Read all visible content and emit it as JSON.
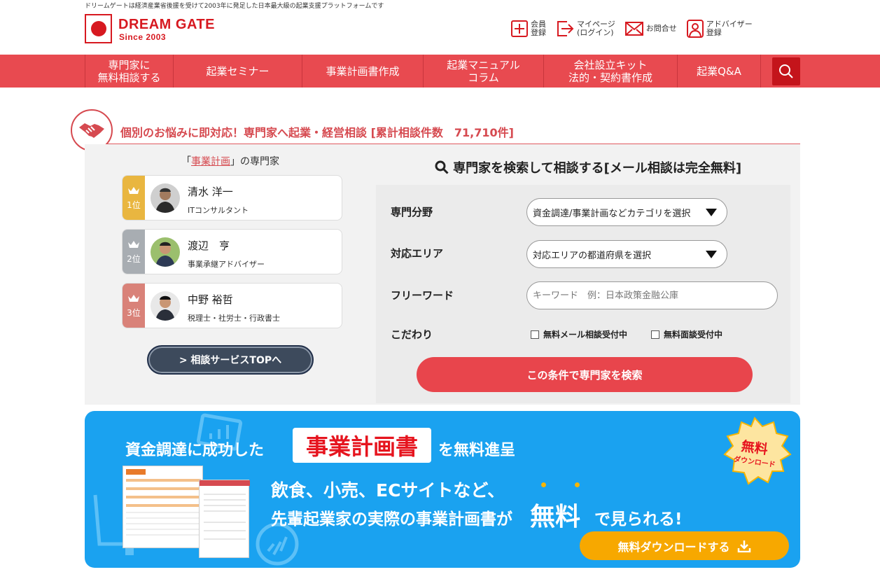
{
  "header": {
    "tagline": "ドリームゲートは経済産業省後援を受けて2003年に発足した日本最大級の起業支援プラットフォームです",
    "logo_name": "DREAM GATE",
    "logo_since": "Since 2003",
    "links": [
      {
        "label": "会員\n登録",
        "icon": "plus-square-icon"
      },
      {
        "label": "マイページ\n(ログイン)",
        "icon": "login-arrow-icon"
      },
      {
        "label": "お問合せ",
        "icon": "mail-icon"
      },
      {
        "label": "アドバイザー\n登録",
        "icon": "advisor-icon"
      }
    ]
  },
  "nav": {
    "items": [
      "専門家に\n無料相談する",
      "起業セミナー",
      "事業計画書作成",
      "起業マニュアル\nコラム",
      "会社設立キット\n法的・契約書作成",
      "起業Q&A"
    ],
    "search_icon": "search-icon"
  },
  "section": {
    "title": "個別のお悩みに即対応！専門家へ起業・経営相談 [累計相談件数　71,710件]",
    "icon": "handshake-icon"
  },
  "experts": {
    "title_prefix": "「",
    "title_highlight": "事業計画",
    "title_suffix": "」の専門家",
    "list": [
      {
        "rank": "1位",
        "name": "清水 洋一",
        "role": "ITコンサルタント"
      },
      {
        "rank": "2位",
        "name": "渡辺　亨",
        "role": "事業承継アドバイザー"
      },
      {
        "rank": "3位",
        "name": "中野 裕哲",
        "role": "税理士・社労士・行政書士"
      }
    ],
    "top_button": "> 相談サービスTOPへ"
  },
  "search": {
    "title": "専門家を検索して相談する[メール相談は完全無料]",
    "field_label": "専門分野",
    "field_value": "資金調達/事業計画などカテゴリを選択",
    "area_label": "対応エリア",
    "area_value": "対応エリアの都道府県を選択",
    "keyword_label": "フリーワード",
    "keyword_placeholder": "キーワード　例：日本政策金融公庫",
    "prefs_label": "こだわり",
    "check1": "無料メール相談受付中",
    "check2": "無料面談受付中",
    "submit": "この条件で専門家を検索"
  },
  "banner": {
    "line1a": "資金調達に成功した",
    "highlight": "事業計画書",
    "line1b": "を無料進呈",
    "line2": "飲食、小売、ECサイトなど、",
    "line3a": "先輩起業家の実際の事業計画書が",
    "line3b": "無料",
    "line3c": "で見られる!",
    "badge1": "無料",
    "badge2": "ダウンロード",
    "cta": "無料ダウンロードする"
  }
}
